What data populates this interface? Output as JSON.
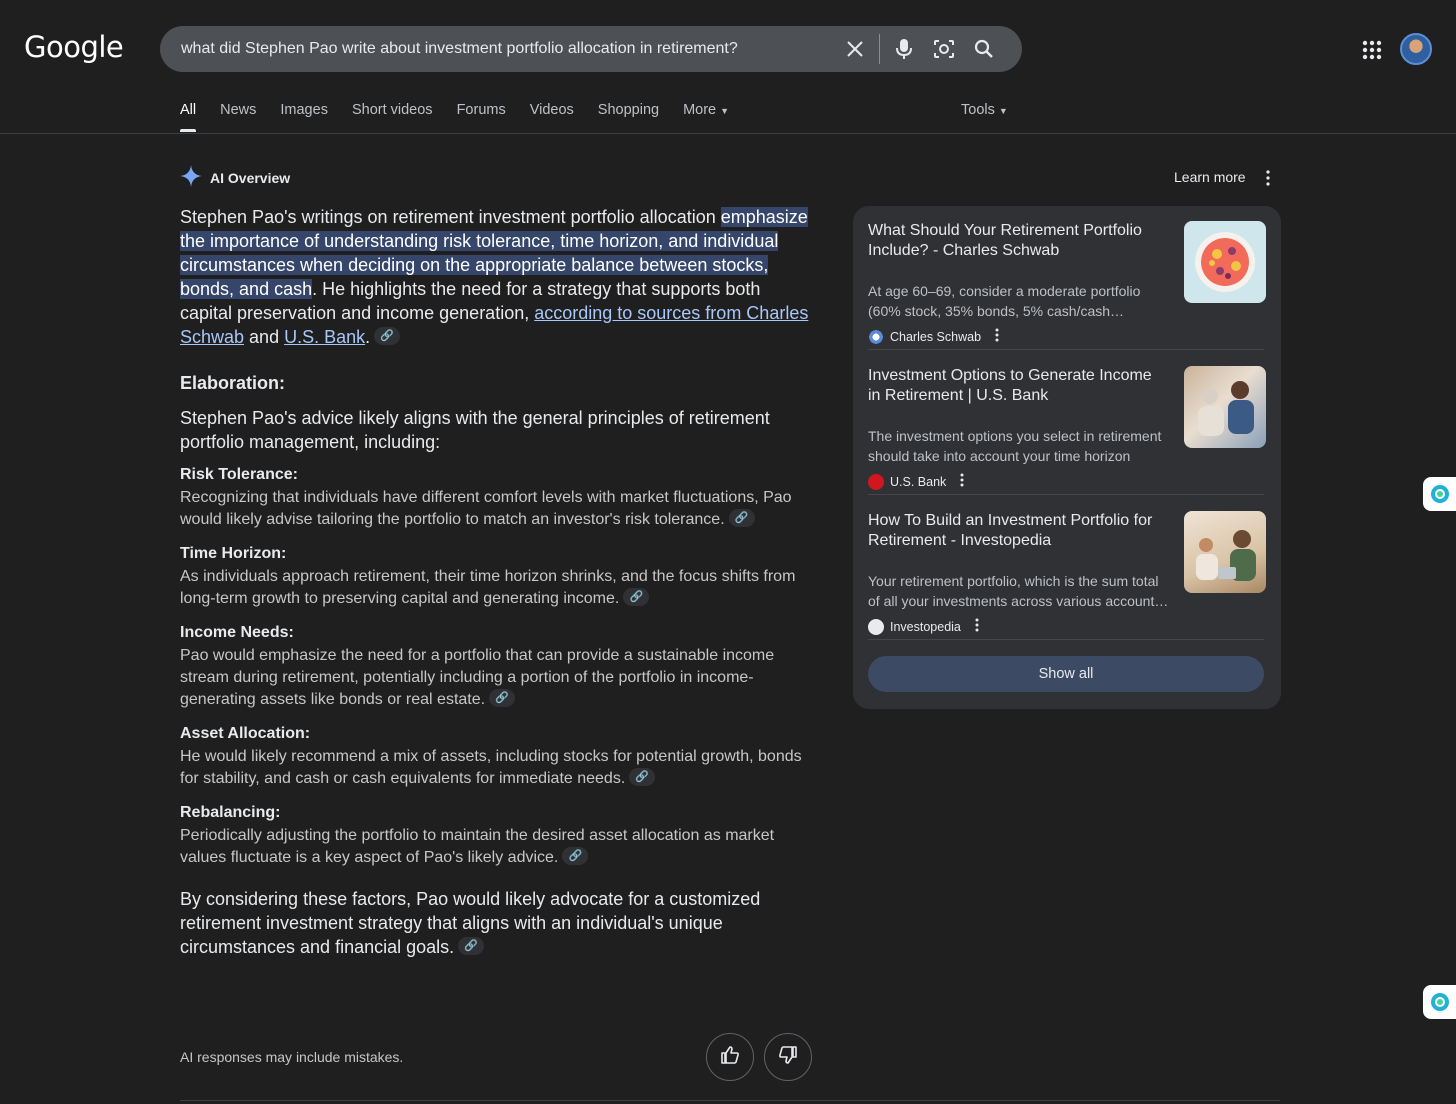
{
  "header": {
    "logo": "Google",
    "search_query": "what did Stephen Pao write about investment portfolio allocation in retirement?"
  },
  "tabs": [
    "All",
    "News",
    "Images",
    "Short videos",
    "Forums",
    "Videos",
    "Shopping",
    "More"
  ],
  "tools_label": "Tools",
  "ai_overview": {
    "title": "AI Overview",
    "learn_more": "Learn more",
    "lead_intro": "Stephen Pao's writings on retirement investment portfolio allocation ",
    "lead_highlight": "emphasize the importance of understanding risk tolerance, time horizon, and individual circumstances when deciding on the appropriate balance between stocks, bonds, and cash",
    "lead_rest": ". He highlights the need for a strategy that supports both capital preservation and income generation, ",
    "lead_link1": "according to sources from Charles Schwab",
    "lead_and": " and ",
    "lead_link2": "U.S. Bank",
    "lead_end": ".",
    "elaboration_heading": "Elaboration:",
    "elaboration_intro": "Stephen Pao's advice likely aligns with the general principles of retirement portfolio management, including:",
    "items": [
      {
        "heading": "Risk Tolerance:",
        "body": "Recognizing that individuals have different comfort levels with market fluctuations, Pao would likely advise tailoring the portfolio to match an investor's risk tolerance."
      },
      {
        "heading": "Time Horizon:",
        "body": "As individuals approach retirement, their time horizon shrinks, and the focus shifts from long-term growth to preserving capital and generating income."
      },
      {
        "heading": "Income Needs:",
        "body": "Pao would emphasize the need for a portfolio that can provide a sustainable income stream during retirement, potentially including a portion of the portfolio in income-generating assets like bonds or real estate."
      },
      {
        "heading": "Asset Allocation:",
        "body": "He would likely recommend a mix of assets, including stocks for potential growth, bonds for stability, and cash or cash equivalents for immediate needs."
      },
      {
        "heading": "Rebalancing:",
        "body": "Periodically adjusting the portfolio to maintain the desired asset allocation as market values fluctuate is a key aspect of Pao's likely advice."
      }
    ],
    "conclusion": "By considering these factors, Pao would likely advocate for a customized retirement investment strategy that aligns with an individual's unique circumstances and financial goals.",
    "disclaimer": "AI responses may include mistakes."
  },
  "sources": [
    {
      "title": "What Should Your Retirement Portfolio Include? - Charles Schwab",
      "snippet": "At age 60–69, consider a moderate portfolio (60% stock, 35% bonds, 5% cash/cash…",
      "site": "Charles Schwab"
    },
    {
      "title": "Investment Options to Generate Income in Retirement | U.S. Bank",
      "snippet": "The investment options you select in retirement should take into account your time horizon and…",
      "site": "U.S. Bank"
    },
    {
      "title": "How To Build an Investment Portfolio for Retirement - Investopedia",
      "snippet": "Your retirement portfolio, which is the sum total of all your investments across various account…",
      "site": "Investopedia"
    }
  ],
  "show_all": "Show all",
  "colors": {
    "background": "#1f1f1f",
    "highlight": "#36466a",
    "link": "#a8c7fa",
    "panel": "#303134"
  }
}
